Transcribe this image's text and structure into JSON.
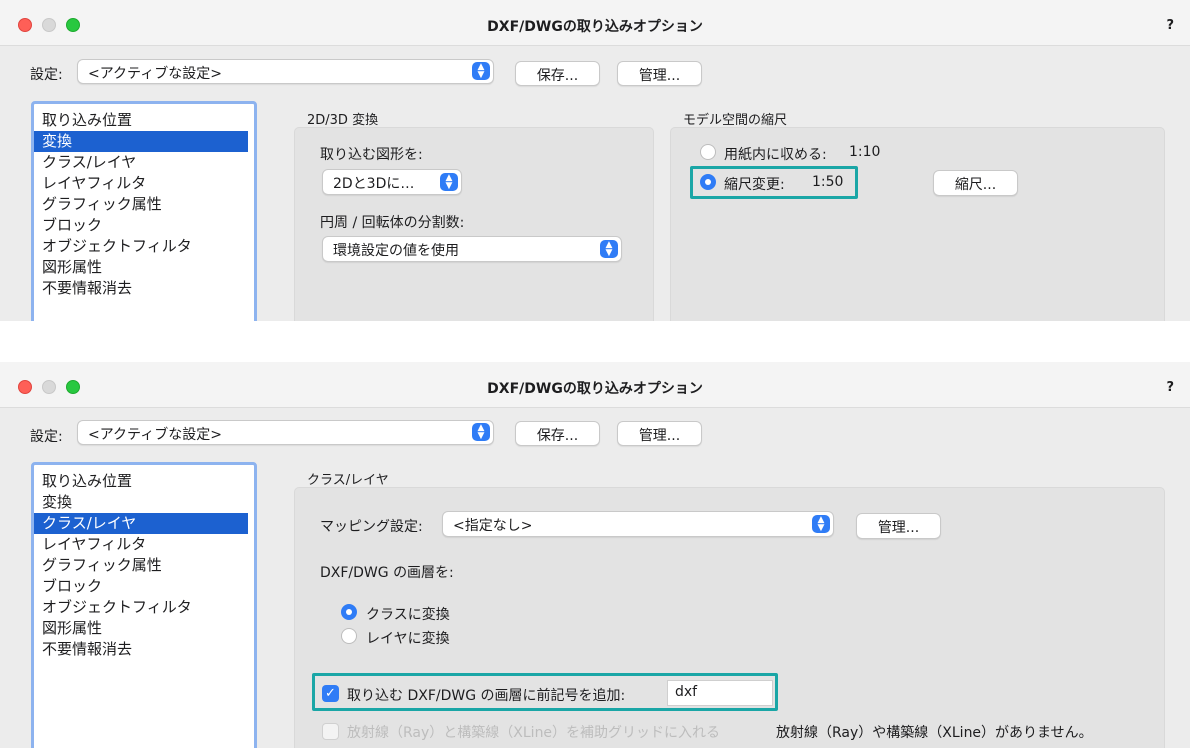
{
  "window_title": "DXF/DWGの取り込みオプション",
  "help_label": "?",
  "settings": {
    "label": "設定:",
    "value": "<アクティブな設定>",
    "save_button": "保存...",
    "manage_button": "管理..."
  },
  "sidebar": {
    "items": [
      "取り込み位置",
      "変換",
      "クラス/レイヤ",
      "レイヤフィルタ",
      "グラフィック属性",
      "ブロック",
      "オブジェクトフィルタ",
      "図形属性",
      "不要情報消去"
    ]
  },
  "screen1": {
    "selected_item": "変換",
    "section_2d3d": "2D/3D 変換",
    "import_shapes_label": "取り込む図形を:",
    "import_shapes_value": "2Dと3Dに…",
    "segments_label": "円周 / 回転体の分割数:",
    "segments_value": "環境設定の値を使用",
    "section_scale": "モデル空間の縮尺",
    "fit_label": "用紙内に収める:",
    "fit_value": "1:10",
    "scale_change_label": "縮尺変更:",
    "scale_change_value": "1:50",
    "scale_button": "縮尺..."
  },
  "screen2": {
    "selected_item": "クラス/レイヤ",
    "section_title": "クラス/レイヤ",
    "mapping_label": "マッピング設定:",
    "mapping_value": "<指定なし>",
    "manage_button": "管理...",
    "layers_label": "DXF/DWG の画層を:",
    "radio_class": "クラスに変換",
    "radio_layer": "レイヤに変換",
    "prefix_label": "取り込む DXF/DWG の画層に前記号を追加:",
    "prefix_value": "dxf",
    "ray_label": "放射線（Ray）と構築線（XLine）を補助グリッドに入れる",
    "ray_note": "放射線（Ray）や構築線（XLine）がありません。"
  },
  "colors": {
    "accent": "#2f7cf6",
    "selection": "#1c61d0",
    "highlight_box": "#1aa6a6"
  },
  "icons": {
    "close": "red-traffic-light",
    "minimize": "gray-traffic-light",
    "zoom": "green-traffic-light",
    "popup": "updown-chevron-icon",
    "check": "checkmark-icon"
  }
}
